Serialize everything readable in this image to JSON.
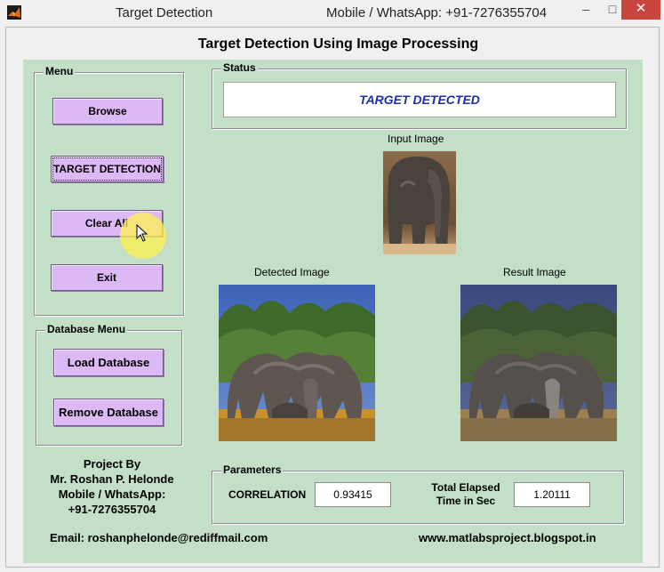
{
  "window": {
    "title": "Target Detection",
    "contact": "Mobile / WhatsApp: +91-7276355704",
    "min_symbol": "–",
    "max_symbol": "□",
    "close_symbol": "✕"
  },
  "heading": "Target Detection Using Image Processing",
  "menu": {
    "title": "Menu",
    "browse": "Browse",
    "target_detection": "TARGET DETECTION",
    "clear_all": "Clear All",
    "exit": "Exit"
  },
  "database_menu": {
    "title": "Database Menu",
    "load": "Load Database",
    "remove": "Remove Database"
  },
  "status": {
    "title": "Status",
    "text": "TARGET DETECTED"
  },
  "images": {
    "input_label": "Input Image",
    "detected_label": "Detected Image",
    "result_label": "Result Image"
  },
  "parameters": {
    "title": "Parameters",
    "correlation_label": "CORRELATION",
    "correlation_value": "0.93415",
    "elapsed_label_1": "Total Elapsed",
    "elapsed_label_2": "Time in Sec",
    "elapsed_value": "1.20111"
  },
  "credits": {
    "line1": "Project By",
    "line2": "Mr. Roshan P. Helonde",
    "line3": "Mobile / WhatsApp:",
    "line4": "+91-7276355704"
  },
  "footer": {
    "email": "Email: roshanphelonde@rediffmail.com",
    "website": "www.matlabsproject.blogspot.in"
  },
  "colors": {
    "panel": "#c3dfc8",
    "button": "#dcb8f5",
    "status_text": "#1f2fa8",
    "close_button": "#c7453c"
  },
  "icons": [
    "matlab-icon",
    "minimize-icon",
    "maximize-icon",
    "close-icon",
    "mouse-cursor-icon"
  ]
}
